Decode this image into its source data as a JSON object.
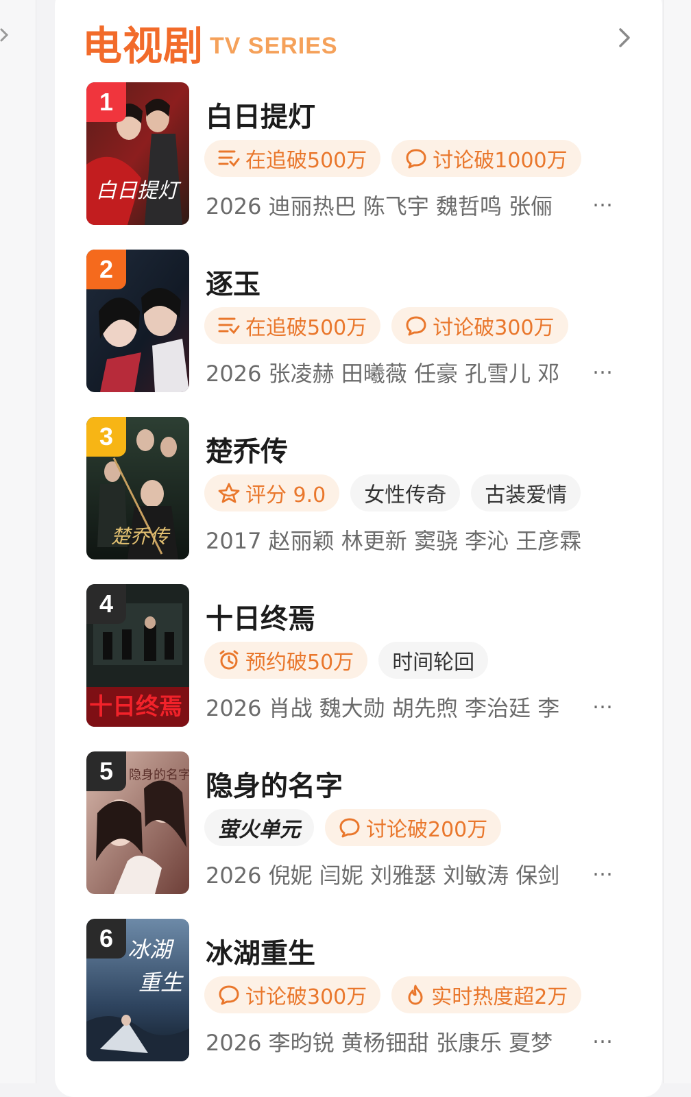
{
  "header": {
    "title_cn": "电视剧",
    "title_en": "TV SERIES",
    "more_icon": "chevron-right-icon"
  },
  "colors": {
    "accent": "#f26b2a",
    "accent_light": "#f5a15a",
    "tag_bg": "#fdf1e6",
    "rank_1": "#f0353d",
    "rank_2": "#f56a1d",
    "rank_3": "#f7b515",
    "rank_other": "#2a2a2a"
  },
  "items": [
    {
      "rank": "1",
      "title": "白日提灯",
      "tags": [
        {
          "icon": "list-follow-icon",
          "text": "在追破500万"
        },
        {
          "icon": "comment-icon",
          "text": "讨论破1000万"
        }
      ],
      "meta": "2026 迪丽热巴 陈飞宇 魏哲鸣 张俪",
      "truncated": "…"
    },
    {
      "rank": "2",
      "title": "逐玉",
      "tags": [
        {
          "icon": "list-follow-icon",
          "text": "在追破500万"
        },
        {
          "icon": "comment-icon",
          "text": "讨论破300万"
        }
      ],
      "meta": "2026 张凌赫 田曦薇 任豪 孔雪儿 邓",
      "truncated": "…"
    },
    {
      "rank": "3",
      "title": "楚乔传",
      "tags": [
        {
          "icon": "star-icon",
          "text": "评分 9.0"
        },
        {
          "icon": "",
          "text": "女性传奇"
        },
        {
          "icon": "",
          "text": "古装爱情"
        }
      ],
      "meta": "2017 赵丽颖 林更新 窦骁 李沁 王彦霖",
      "truncated": ""
    },
    {
      "rank": "4",
      "title": "十日终焉",
      "tags": [
        {
          "icon": "alarm-icon",
          "text": "预约破50万"
        },
        {
          "icon": "",
          "text": "时间轮回"
        }
      ],
      "meta": "2026 肖战 魏大勋 胡先煦 李治廷 李",
      "truncated": "…"
    },
    {
      "rank": "5",
      "title": "隐身的名字",
      "tags": [
        {
          "icon": "",
          "text": "萤火单元"
        },
        {
          "icon": "comment-icon",
          "text": "讨论破200万"
        }
      ],
      "meta": "2026 倪妮 闫妮 刘雅瑟 刘敏涛 保剑",
      "truncated": "…"
    },
    {
      "rank": "6",
      "title": "冰湖重生",
      "tags": [
        {
          "icon": "comment-icon",
          "text": "讨论破300万"
        },
        {
          "icon": "flame-icon",
          "text": "实时热度超2万"
        }
      ],
      "meta": "2026 李昀锐 黄杨钿甜 张康乐 夏梦",
      "truncated": "…"
    }
  ]
}
